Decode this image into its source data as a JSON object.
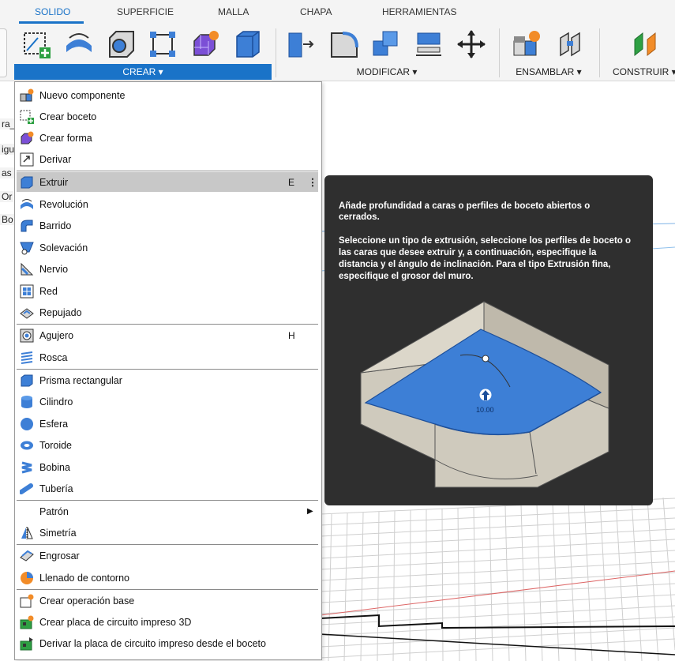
{
  "tabs": [
    {
      "label": "SOLIDO",
      "active": true
    },
    {
      "label": "SUPERFICIE",
      "active": false
    },
    {
      "label": "MALLA",
      "active": false
    },
    {
      "label": "CHAPA",
      "active": false
    },
    {
      "label": "HERRAMIENTAS",
      "active": false
    }
  ],
  "toolbar": {
    "groups": {
      "crear": "CREAR ▾",
      "modificar": "MODIFICAR ▾",
      "ensamblar": "ENSAMBLAR ▾",
      "construir": "CONSTRUIR ▾"
    }
  },
  "browser_stub": [
    "ra_",
    "igu",
    "as g",
    "Or",
    "Bo"
  ],
  "menu": {
    "items": [
      {
        "label": "Nuevo componente",
        "icon": "new-component-icon",
        "shortcut": ""
      },
      {
        "label": "Crear boceto",
        "icon": "create-sketch-icon",
        "shortcut": ""
      },
      {
        "label": "Crear forma",
        "icon": "create-form-icon",
        "shortcut": ""
      },
      {
        "label": "Derivar",
        "icon": "derive-icon",
        "shortcut": ""
      },
      {
        "label": "Extruir",
        "icon": "extrude-icon",
        "shortcut": "E",
        "highlighted": true
      },
      {
        "label": "Revolución",
        "icon": "revolve-icon",
        "shortcut": ""
      },
      {
        "label": "Barrido",
        "icon": "sweep-icon",
        "shortcut": ""
      },
      {
        "label": "Solevación",
        "icon": "loft-icon",
        "shortcut": ""
      },
      {
        "label": "Nervio",
        "icon": "rib-icon",
        "shortcut": ""
      },
      {
        "label": "Red",
        "icon": "web-icon",
        "shortcut": ""
      },
      {
        "label": "Repujado",
        "icon": "emboss-icon",
        "shortcut": ""
      },
      {
        "label": "Agujero",
        "icon": "hole-icon",
        "shortcut": "H"
      },
      {
        "label": "Rosca",
        "icon": "thread-icon",
        "shortcut": ""
      },
      {
        "label": "Prisma rectangular",
        "icon": "box-icon",
        "shortcut": ""
      },
      {
        "label": "Cilindro",
        "icon": "cylinder-icon",
        "shortcut": ""
      },
      {
        "label": "Esfera",
        "icon": "sphere-icon",
        "shortcut": ""
      },
      {
        "label": "Toroide",
        "icon": "torus-icon",
        "shortcut": ""
      },
      {
        "label": "Bobina",
        "icon": "coil-icon",
        "shortcut": ""
      },
      {
        "label": "Tubería",
        "icon": "pipe-icon",
        "shortcut": ""
      },
      {
        "label": "Patrón",
        "icon": "",
        "shortcut": "",
        "submenu": true
      },
      {
        "label": "Simetría",
        "icon": "mirror-icon",
        "shortcut": ""
      },
      {
        "label": "Engrosar",
        "icon": "thicken-icon",
        "shortcut": ""
      },
      {
        "label": "Llenado de contorno",
        "icon": "boundary-fill-icon",
        "shortcut": ""
      },
      {
        "label": "Crear operación base",
        "icon": "base-feature-icon",
        "shortcut": ""
      },
      {
        "label": "Crear placa de circuito impreso 3D",
        "icon": "pcb-3d-icon",
        "shortcut": ""
      },
      {
        "label": "Derivar la placa de circuito impreso desde el boceto",
        "icon": "pcb-derive-icon",
        "shortcut": ""
      }
    ]
  },
  "tooltip": {
    "p1": "Añade profundidad a caras o perfiles de boceto abiertos o cerrados.",
    "p2": "Seleccione un tipo de extrusión, seleccione los perfiles de boceto o las caras que desee extruir y, a continuación, especifique la distancia y el ángulo de inclinación. Para el tipo Extrusión fina, especifique el grosor del muro.",
    "dimension": "10.00"
  },
  "colors": {
    "accent": "#1a73c8",
    "highlight": "#c8c8c8",
    "tooltip_bg": "#2f2f2f",
    "extrude_blue": "#3d7fd6"
  }
}
